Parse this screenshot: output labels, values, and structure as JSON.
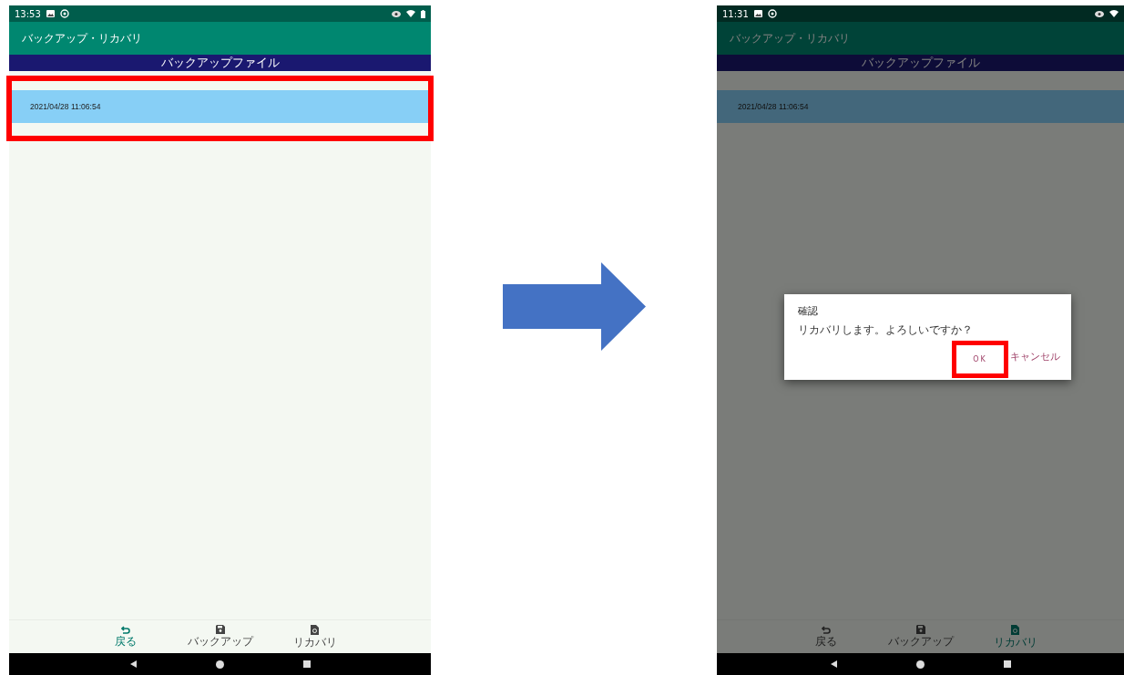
{
  "screens": [
    {
      "status_time": "13:53",
      "dimmed": false,
      "app_title": "バックアップ・リカバリ",
      "header": "バックアップファイル",
      "rows": [
        {
          "text": "2021/04/28 11:06:54",
          "selected": true,
          "highlighted": true
        }
      ],
      "nav": [
        {
          "kind": "back",
          "label": "戻る",
          "selected": true
        },
        {
          "kind": "save",
          "label": "バックアップ",
          "selected": false
        },
        {
          "kind": "restore",
          "label": "リカバリ",
          "selected": false
        }
      ]
    },
    {
      "status_time": "11:31",
      "dimmed": true,
      "app_title": "バックアップ・リカバリ",
      "header": "バックアップファイル",
      "rows": [
        {
          "text": "2021/04/28 11:06:54",
          "selected": true,
          "highlighted": false
        }
      ],
      "nav": [
        {
          "kind": "back",
          "label": "戻る",
          "selected": false
        },
        {
          "kind": "save",
          "label": "バックアップ",
          "selected": false
        },
        {
          "kind": "restore",
          "label": "リカバリ",
          "selected": true
        }
      ],
      "dialog": {
        "title": "確認",
        "message": "リカバリします。よろしいですか？",
        "buttons": [
          {
            "label": "OK",
            "highlighted": true
          },
          {
            "label": "キャンセル",
            "highlighted": false
          }
        ]
      }
    }
  ]
}
